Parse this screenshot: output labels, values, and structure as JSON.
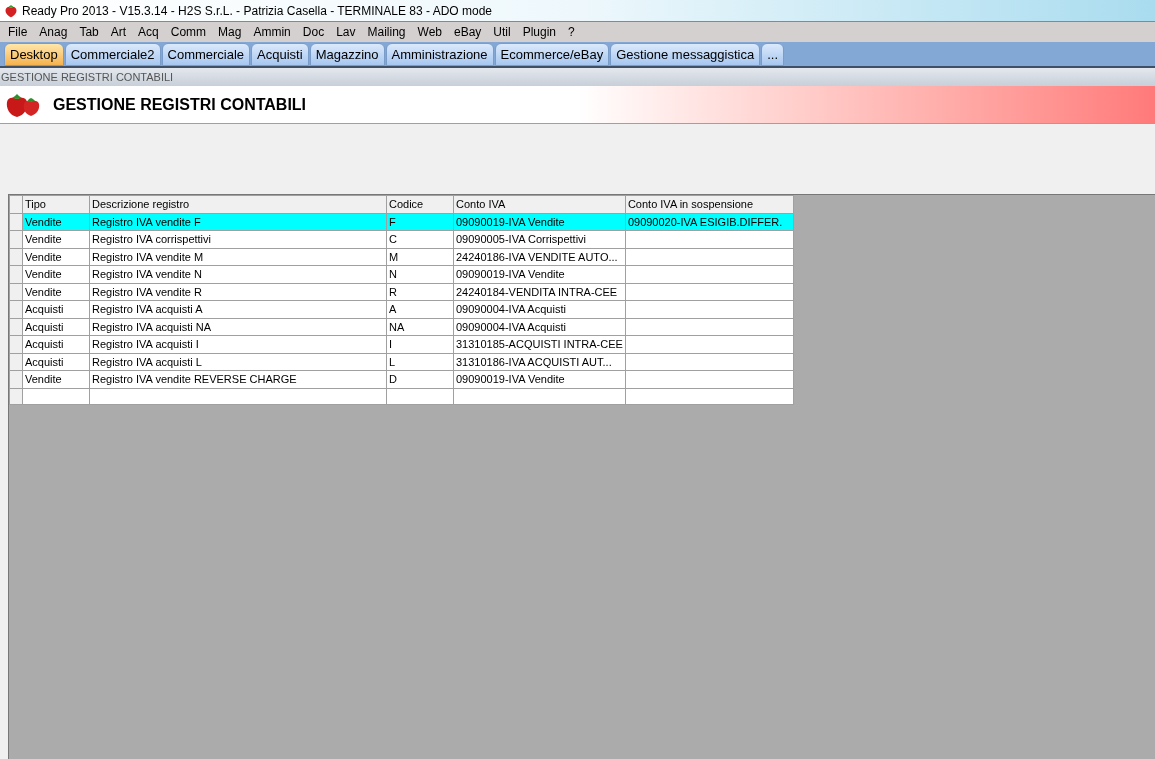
{
  "window": {
    "title": "Ready Pro 2013 - V15.3.14 - H2S S.r.L. - Patrizia Casella - TERMINALE 83 - ADO mode"
  },
  "menu": [
    "File",
    "Anag",
    "Tab",
    "Art",
    "Acq",
    "Comm",
    "Mag",
    "Ammin",
    "Doc",
    "Lav",
    "Mailing",
    "Web",
    "eBay",
    "Util",
    "Plugin",
    "?"
  ],
  "tabs": [
    {
      "label": "Desktop",
      "selected": true
    },
    {
      "label": "Commerciale2",
      "selected": false
    },
    {
      "label": "Commerciale",
      "selected": false
    },
    {
      "label": "Acquisti",
      "selected": false
    },
    {
      "label": "Magazzino",
      "selected": false
    },
    {
      "label": "Amministrazione",
      "selected": false
    },
    {
      "label": "Ecommerce/eBay",
      "selected": false
    },
    {
      "label": "Gestione messaggistica",
      "selected": false
    },
    {
      "label": "...",
      "selected": false
    }
  ],
  "breadcrumb": "GESTIONE REGISTRI CONTABILI",
  "header": {
    "title": "GESTIONE REGISTRI CONTABILI"
  },
  "table": {
    "columns": [
      "Tipo",
      "Descrizione registro",
      "Codice",
      "Conto IVA",
      "Conto IVA in sospensione"
    ],
    "rows": [
      {
        "selected": true,
        "cells": [
          "Vendite",
          "Registro IVA vendite F",
          "F",
          "09090019-IVA Vendite",
          "09090020-IVA ESIGIB.DIFFER."
        ]
      },
      {
        "selected": false,
        "cells": [
          "Vendite",
          "Registro IVA corrispettivi",
          "C",
          "09090005-IVA Corrispettivi",
          ""
        ]
      },
      {
        "selected": false,
        "cells": [
          "Vendite",
          "Registro IVA vendite M",
          "M",
          "24240186-IVA VENDITE AUTO...",
          ""
        ]
      },
      {
        "selected": false,
        "cells": [
          "Vendite",
          "Registro IVA vendite N",
          "N",
          "09090019-IVA Vendite",
          ""
        ]
      },
      {
        "selected": false,
        "cells": [
          "Vendite",
          "Registro IVA vendite R",
          "R",
          "24240184-VENDITA INTRA-CEE",
          ""
        ]
      },
      {
        "selected": false,
        "cells": [
          "Acquisti",
          "Registro IVA acquisti A",
          "A",
          "09090004-IVA Acquisti",
          ""
        ]
      },
      {
        "selected": false,
        "cells": [
          "Acquisti",
          "Registro IVA acquisti NA",
          "NA",
          "09090004-IVA Acquisti",
          ""
        ]
      },
      {
        "selected": false,
        "cells": [
          "Acquisti",
          "Registro IVA acquisti I",
          "I",
          "31310185-ACQUISTI INTRA-CEE",
          ""
        ]
      },
      {
        "selected": false,
        "cells": [
          "Acquisti",
          "Registro IVA acquisti L",
          "L",
          "31310186-IVA ACQUISTI AUT...",
          ""
        ]
      },
      {
        "selected": false,
        "cells": [
          "Vendite",
          "Registro IVA vendite REVERSE CHARGE",
          "D",
          "09090019-IVA Vendite",
          ""
        ]
      }
    ]
  }
}
